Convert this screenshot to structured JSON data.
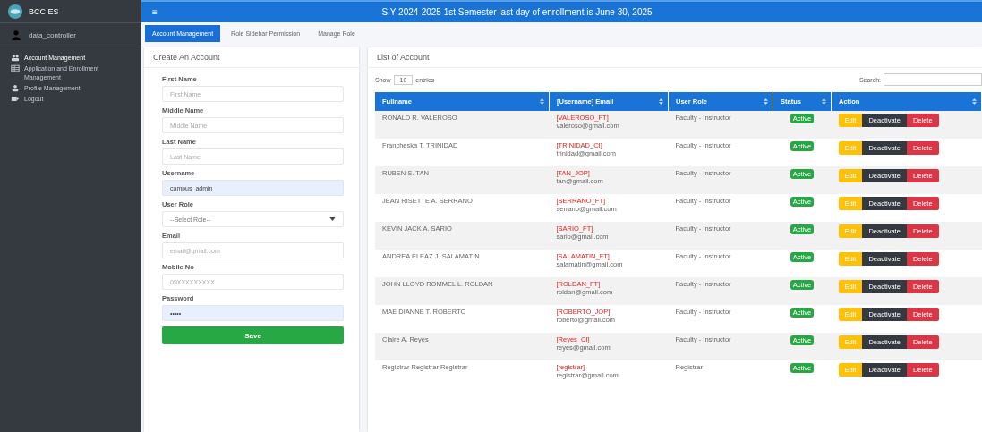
{
  "sidebar": {
    "brand": "BCC ES",
    "user": "data_controller",
    "items": [
      {
        "label": "Account Management",
        "selected": true
      },
      {
        "label": "Application and Enrollment Management",
        "selected": false
      },
      {
        "label": "Profile Management",
        "selected": false
      },
      {
        "label": "Logout",
        "selected": false
      }
    ]
  },
  "topbar": {
    "menu": "≡",
    "banner": "S.Y 2024-2025 1st Semester last day of enrollment is June 30, 2025"
  },
  "tabs": [
    {
      "label": "Account Management",
      "selected": true
    },
    {
      "label": "Role Sidebar Permission",
      "selected": false
    },
    {
      "label": "Manage Role",
      "selected": false
    }
  ],
  "form": {
    "title": "Create An Account",
    "fields": [
      {
        "label": "First Name",
        "kind": "text",
        "placeholder": "First Name"
      },
      {
        "label": "Middle Name",
        "kind": "text",
        "placeholder": "Middle Name"
      },
      {
        "label": "Last Name",
        "kind": "text",
        "placeholder": "Last Name"
      },
      {
        "label": "Username",
        "kind": "autofill",
        "value": "campus_admin"
      },
      {
        "label": "User Role",
        "kind": "select",
        "value": "--Select Role--"
      },
      {
        "label": "Email",
        "kind": "text",
        "placeholder": "email@gmail.com"
      },
      {
        "label": "Mobile No",
        "kind": "text",
        "placeholder": "09XXXXXXXXX"
      },
      {
        "label": "Password",
        "kind": "autofill",
        "value": "•••••"
      }
    ],
    "submit": "Save"
  },
  "list": {
    "title": "List of Account",
    "show": "Show",
    "entries_value": "10",
    "entries": "entries",
    "search": "Search:",
    "columns": [
      "Fullname",
      "[Username] Email",
      "User Role",
      "Status",
      "Action"
    ],
    "rows": [
      {
        "fullname": "RONALD R. VALEROSO",
        "username": "[VALEROSO_FT]",
        "email": "valeroso@gmail.com",
        "role": "Faculty - Instructor",
        "status": "Active",
        "actions": [
          "Edit",
          "Deactivate",
          "Delete"
        ]
      },
      {
        "fullname": "Francheska T. TRINIDAD",
        "username": "[TRINIDAD_CI]",
        "email": "trinidad@gmail.com",
        "role": "Faculty - Instructor",
        "status": "Active",
        "actions": [
          "Edit",
          "Deactivate",
          "Delete"
        ]
      },
      {
        "fullname": "RUBEN S. TAN",
        "username": "[TAN_JOP]",
        "email": "tan@gmail.com",
        "role": "Faculty - Instructor",
        "status": "Active",
        "actions": [
          "Edit",
          "Deactivate",
          "Delete"
        ]
      },
      {
        "fullname": "JEAN RISETTE A. SERRANO",
        "username": "[SERRANO_FT]",
        "email": "serrano@gmail.com",
        "role": "Faculty - Instructor",
        "status": "Active",
        "actions": [
          "Edit",
          "Deactivate",
          "Delete"
        ]
      },
      {
        "fullname": "KEVIN JACK A. SARIO",
        "username": "[SARIO_FT]",
        "email": "sario@gmail.com",
        "role": "Faculty - Instructor",
        "status": "Active",
        "actions": [
          "Edit",
          "Deactivate",
          "Delete"
        ]
      },
      {
        "fullname": "ANDREA ELEAZ J. SALAMATIN",
        "username": "[SALAMATIN_FT]",
        "email": "salamatin@gmail.com",
        "role": "Faculty - Instructor",
        "status": "Active",
        "actions": [
          "Edit",
          "Deactivate",
          "Delete"
        ]
      },
      {
        "fullname": "JOHN LLOYD ROMMEL L. ROLDAN",
        "username": "[ROLDAN_FT]",
        "email": "roldan@gmail.com",
        "role": "Faculty - Instructor",
        "status": "Active",
        "actions": [
          "Edit",
          "Deactivate",
          "Delete"
        ]
      },
      {
        "fullname": "MAE DIANNE T. ROBERTO",
        "username": "[ROBERTO_JOP]",
        "email": "roberto@gmail.com",
        "role": "Faculty - Instructor",
        "status": "Active",
        "actions": [
          "Edit",
          "Deactivate",
          "Delete"
        ]
      },
      {
        "fullname": "Claire A. Reyes",
        "username": "[Reyes_CI]",
        "email": "reyes@gmail.com",
        "role": "Faculty - Instructor",
        "status": "Active",
        "actions": [
          "Edit",
          "Deactivate",
          "Delete"
        ]
      },
      {
        "fullname": "Registrar Registrar Registrar",
        "username": "[registrar]",
        "email": "registrar@gmail.com",
        "role": "Registrar",
        "status": "Active",
        "actions": [
          "Edit",
          "Deactivate",
          "Delete"
        ]
      }
    ]
  }
}
